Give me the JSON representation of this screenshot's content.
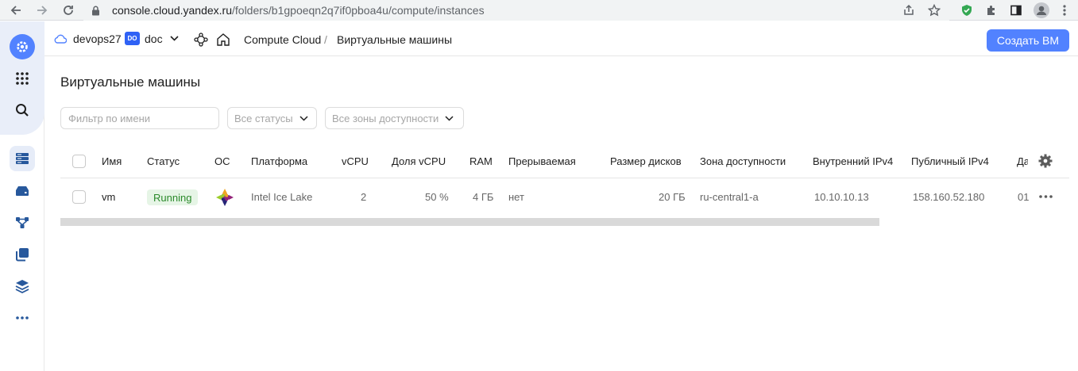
{
  "browser": {
    "url_host": "console.cloud.yandex.ru",
    "url_path": "/folders/b1gpoeqn2q7if0pboa4u/compute/instances"
  },
  "header": {
    "cloud_name": "devops27",
    "folder_badge": "DO",
    "folder_name": "doc",
    "service": "Compute Cloud",
    "separator": "/",
    "current_page": "Виртуальные машины",
    "create_button": "Создать ВМ"
  },
  "main": {
    "title": "Виртуальные машины",
    "filter_placeholder": "Фильтр по имени",
    "status_select": "Все статусы",
    "zone_select": "Все зоны доступности"
  },
  "table": {
    "columns": [
      "Имя",
      "Статус",
      "ОС",
      "Платформа",
      "vCPU",
      "Доля vCPU",
      "RAM",
      "Прерываемая",
      "Размер дисков",
      "Зона доступности",
      "Внутренний IPv4",
      "Публичный IPv4",
      "Да"
    ],
    "rows": [
      {
        "name": "vm",
        "status": "Running",
        "os_icon": "centos-icon",
        "platform": "Intel Ice Lake",
        "vcpu": "2",
        "vcpu_share": "50 %",
        "ram": "4 ГБ",
        "preemptible": "нет",
        "disk_size": "20 ГБ",
        "zone": "ru-central1-a",
        "internal_ip": "10.10.10.13",
        "public_ip": "158.160.52.180",
        "date": "01"
      }
    ]
  },
  "colors": {
    "accent": "#5282ff",
    "status_running_bg": "#e6f5e6",
    "status_running_text": "#2b8a2b"
  }
}
